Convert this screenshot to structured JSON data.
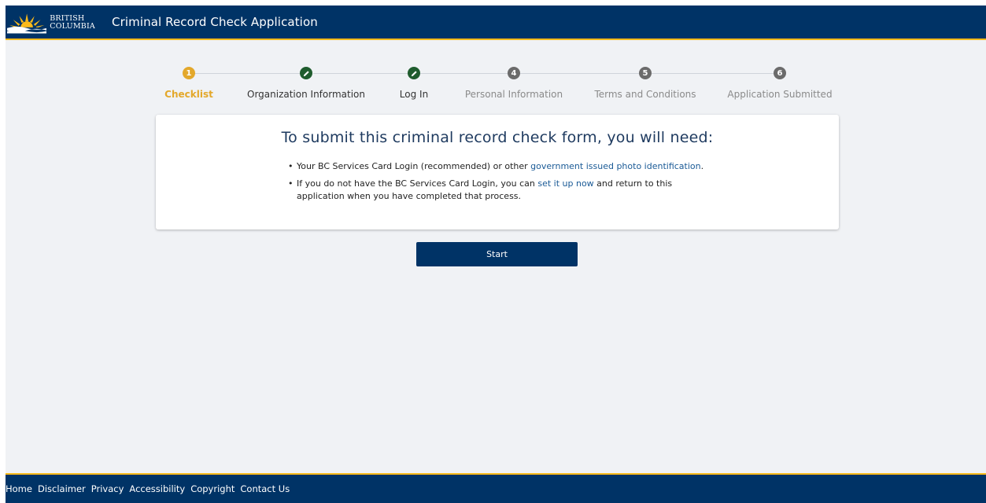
{
  "header": {
    "logo_line1": "BRITISH",
    "logo_line2": "COLUMBIA",
    "title": "Criminal Record Check Application",
    "colors": {
      "navy": "#003366",
      "gold": "#fcba19"
    }
  },
  "stepper": {
    "steps": [
      {
        "number": "1",
        "label": "Checklist",
        "state": "active",
        "icon": "number"
      },
      {
        "number": "",
        "label": "Organization Information",
        "state": "done",
        "icon": "pencil-icon"
      },
      {
        "number": "",
        "label": "Log In",
        "state": "done",
        "icon": "pencil-icon"
      },
      {
        "number": "4",
        "label": "Personal Information",
        "state": "pending",
        "icon": "number"
      },
      {
        "number": "5",
        "label": "Terms and Conditions",
        "state": "pending",
        "icon": "number"
      },
      {
        "number": "6",
        "label": "Application Submitted",
        "state": "pending",
        "icon": "number"
      }
    ],
    "colors": {
      "active": "#e3a82b",
      "done": "#1f5c2e",
      "pending": "#6b6b6b"
    }
  },
  "card": {
    "title": "To submit this criminal record check form, you will need:",
    "item1_text": "Your BC Services Card Login (recommended) or other ",
    "item1_link": "government issued photo identification",
    "item1_end": ".",
    "item2_text": "If you do not have the BC Services Card Login, you can ",
    "item2_link": "set it up now",
    "item2_end": " and return to this application when you have completed that process."
  },
  "start_button": {
    "label": "Start"
  },
  "footer": {
    "links": [
      "Home",
      "Disclaimer",
      "Privacy",
      "Accessibility",
      "Copyright",
      "Contact Us"
    ]
  }
}
